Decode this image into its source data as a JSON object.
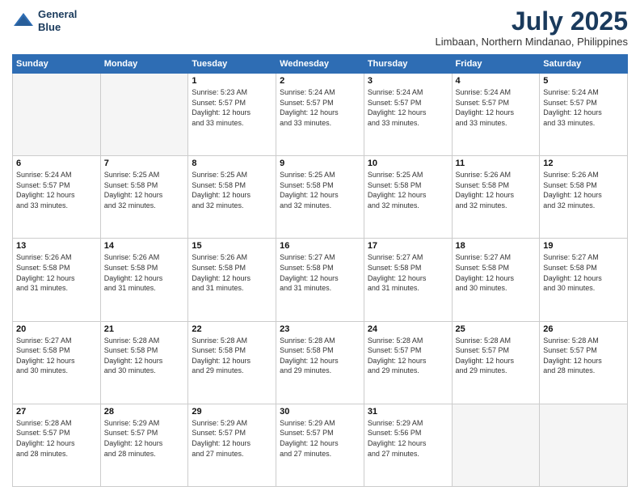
{
  "header": {
    "logo_line1": "General",
    "logo_line2": "Blue",
    "month_title": "July 2025",
    "location": "Limbaan, Northern Mindanao, Philippines"
  },
  "columns": [
    "Sunday",
    "Monday",
    "Tuesday",
    "Wednesday",
    "Thursday",
    "Friday",
    "Saturday"
  ],
  "weeks": [
    [
      {
        "day": "",
        "detail": ""
      },
      {
        "day": "",
        "detail": ""
      },
      {
        "day": "1",
        "detail": "Sunrise: 5:23 AM\nSunset: 5:57 PM\nDaylight: 12 hours\nand 33 minutes."
      },
      {
        "day": "2",
        "detail": "Sunrise: 5:24 AM\nSunset: 5:57 PM\nDaylight: 12 hours\nand 33 minutes."
      },
      {
        "day": "3",
        "detail": "Sunrise: 5:24 AM\nSunset: 5:57 PM\nDaylight: 12 hours\nand 33 minutes."
      },
      {
        "day": "4",
        "detail": "Sunrise: 5:24 AM\nSunset: 5:57 PM\nDaylight: 12 hours\nand 33 minutes."
      },
      {
        "day": "5",
        "detail": "Sunrise: 5:24 AM\nSunset: 5:57 PM\nDaylight: 12 hours\nand 33 minutes."
      }
    ],
    [
      {
        "day": "6",
        "detail": "Sunrise: 5:24 AM\nSunset: 5:57 PM\nDaylight: 12 hours\nand 33 minutes."
      },
      {
        "day": "7",
        "detail": "Sunrise: 5:25 AM\nSunset: 5:58 PM\nDaylight: 12 hours\nand 32 minutes."
      },
      {
        "day": "8",
        "detail": "Sunrise: 5:25 AM\nSunset: 5:58 PM\nDaylight: 12 hours\nand 32 minutes."
      },
      {
        "day": "9",
        "detail": "Sunrise: 5:25 AM\nSunset: 5:58 PM\nDaylight: 12 hours\nand 32 minutes."
      },
      {
        "day": "10",
        "detail": "Sunrise: 5:25 AM\nSunset: 5:58 PM\nDaylight: 12 hours\nand 32 minutes."
      },
      {
        "day": "11",
        "detail": "Sunrise: 5:26 AM\nSunset: 5:58 PM\nDaylight: 12 hours\nand 32 minutes."
      },
      {
        "day": "12",
        "detail": "Sunrise: 5:26 AM\nSunset: 5:58 PM\nDaylight: 12 hours\nand 32 minutes."
      }
    ],
    [
      {
        "day": "13",
        "detail": "Sunrise: 5:26 AM\nSunset: 5:58 PM\nDaylight: 12 hours\nand 31 minutes."
      },
      {
        "day": "14",
        "detail": "Sunrise: 5:26 AM\nSunset: 5:58 PM\nDaylight: 12 hours\nand 31 minutes."
      },
      {
        "day": "15",
        "detail": "Sunrise: 5:26 AM\nSunset: 5:58 PM\nDaylight: 12 hours\nand 31 minutes."
      },
      {
        "day": "16",
        "detail": "Sunrise: 5:27 AM\nSunset: 5:58 PM\nDaylight: 12 hours\nand 31 minutes."
      },
      {
        "day": "17",
        "detail": "Sunrise: 5:27 AM\nSunset: 5:58 PM\nDaylight: 12 hours\nand 31 minutes."
      },
      {
        "day": "18",
        "detail": "Sunrise: 5:27 AM\nSunset: 5:58 PM\nDaylight: 12 hours\nand 30 minutes."
      },
      {
        "day": "19",
        "detail": "Sunrise: 5:27 AM\nSunset: 5:58 PM\nDaylight: 12 hours\nand 30 minutes."
      }
    ],
    [
      {
        "day": "20",
        "detail": "Sunrise: 5:27 AM\nSunset: 5:58 PM\nDaylight: 12 hours\nand 30 minutes."
      },
      {
        "day": "21",
        "detail": "Sunrise: 5:28 AM\nSunset: 5:58 PM\nDaylight: 12 hours\nand 30 minutes."
      },
      {
        "day": "22",
        "detail": "Sunrise: 5:28 AM\nSunset: 5:58 PM\nDaylight: 12 hours\nand 29 minutes."
      },
      {
        "day": "23",
        "detail": "Sunrise: 5:28 AM\nSunset: 5:58 PM\nDaylight: 12 hours\nand 29 minutes."
      },
      {
        "day": "24",
        "detail": "Sunrise: 5:28 AM\nSunset: 5:57 PM\nDaylight: 12 hours\nand 29 minutes."
      },
      {
        "day": "25",
        "detail": "Sunrise: 5:28 AM\nSunset: 5:57 PM\nDaylight: 12 hours\nand 29 minutes."
      },
      {
        "day": "26",
        "detail": "Sunrise: 5:28 AM\nSunset: 5:57 PM\nDaylight: 12 hours\nand 28 minutes."
      }
    ],
    [
      {
        "day": "27",
        "detail": "Sunrise: 5:28 AM\nSunset: 5:57 PM\nDaylight: 12 hours\nand 28 minutes."
      },
      {
        "day": "28",
        "detail": "Sunrise: 5:29 AM\nSunset: 5:57 PM\nDaylight: 12 hours\nand 28 minutes."
      },
      {
        "day": "29",
        "detail": "Sunrise: 5:29 AM\nSunset: 5:57 PM\nDaylight: 12 hours\nand 27 minutes."
      },
      {
        "day": "30",
        "detail": "Sunrise: 5:29 AM\nSunset: 5:57 PM\nDaylight: 12 hours\nand 27 minutes."
      },
      {
        "day": "31",
        "detail": "Sunrise: 5:29 AM\nSunset: 5:56 PM\nDaylight: 12 hours\nand 27 minutes."
      },
      {
        "day": "",
        "detail": ""
      },
      {
        "day": "",
        "detail": ""
      }
    ]
  ]
}
